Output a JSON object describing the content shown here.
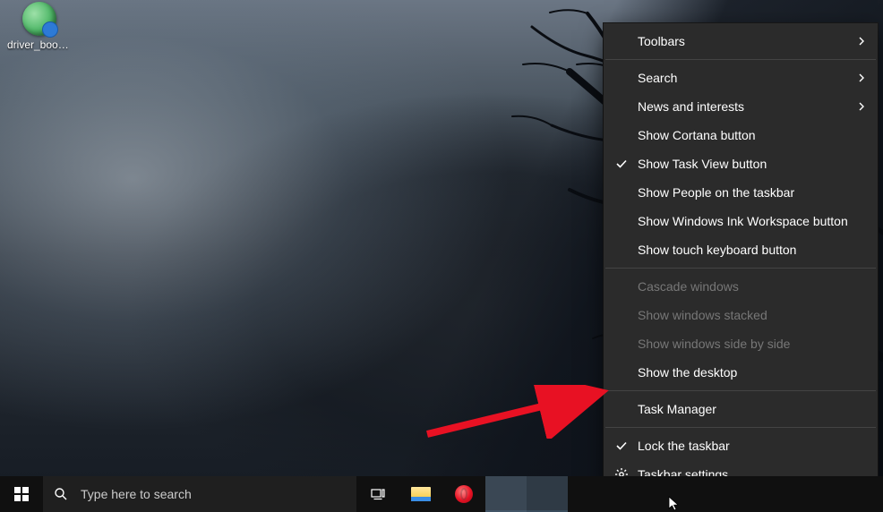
{
  "desktop": {
    "icons": [
      {
        "label": "driver_boos..."
      }
    ]
  },
  "taskbar": {
    "search_placeholder": "Type here to search"
  },
  "context_menu": {
    "items": [
      {
        "label": "Toolbars",
        "submenu": true
      },
      {
        "label": "Search",
        "submenu": true
      },
      {
        "label": "News and interests",
        "submenu": true
      },
      {
        "label": "Show Cortana button"
      },
      {
        "label": "Show Task View button",
        "checked": true
      },
      {
        "label": "Show People on the taskbar"
      },
      {
        "label": "Show Windows Ink Workspace button"
      },
      {
        "label": "Show touch keyboard button"
      },
      {
        "label": "Cascade windows",
        "disabled": true
      },
      {
        "label": "Show windows stacked",
        "disabled": true
      },
      {
        "label": "Show windows side by side",
        "disabled": true
      },
      {
        "label": "Show the desktop"
      },
      {
        "label": "Task Manager"
      },
      {
        "label": "Lock the taskbar",
        "checked": true
      },
      {
        "label": "Taskbar settings",
        "icon": "gear"
      }
    ]
  }
}
